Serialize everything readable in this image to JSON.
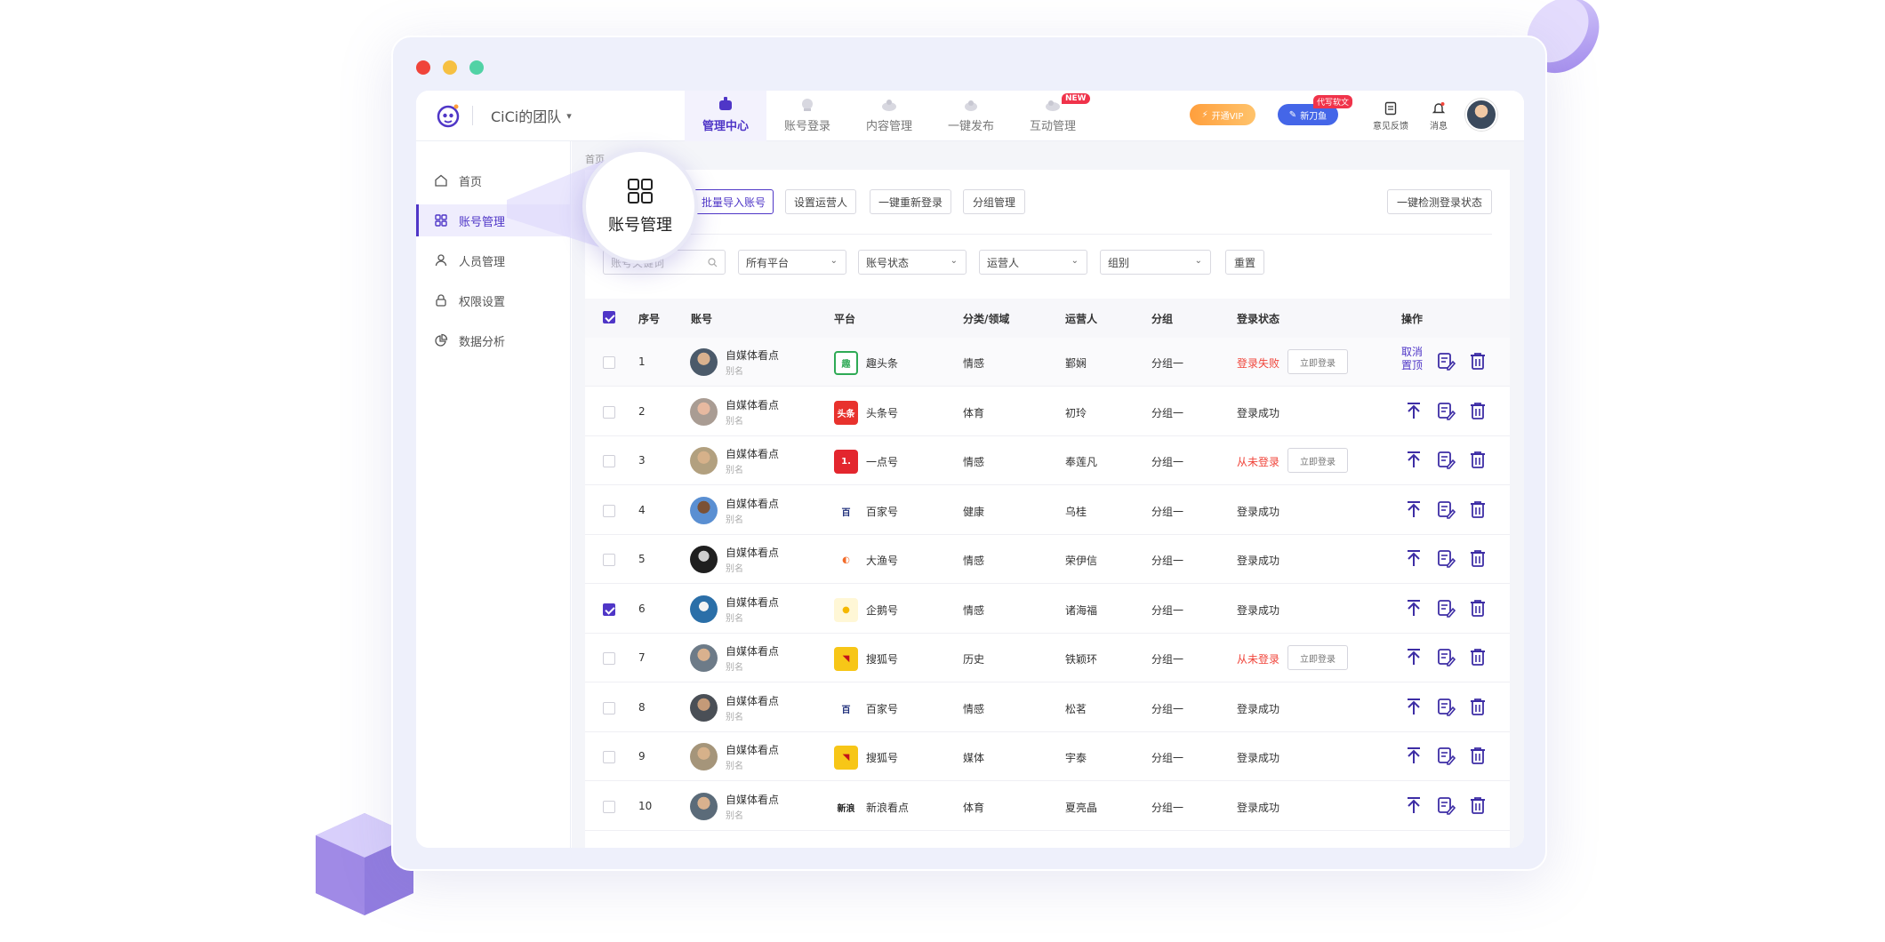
{
  "team": {
    "name": "CiCi的团队"
  },
  "nav": {
    "items": [
      {
        "label": "管理中心",
        "active": true
      },
      {
        "label": "账号登录"
      },
      {
        "label": "内容管理"
      },
      {
        "label": "一键发布"
      },
      {
        "label": "互动管理",
        "badge": "NEW"
      }
    ]
  },
  "topright": {
    "vip_label": "开通VIP",
    "tool_label": "新刀鱼",
    "tool_tag": "代写软文",
    "feedback_label": "意见反馈",
    "message_label": "消息"
  },
  "sidebar": {
    "items": [
      {
        "label": "首页"
      },
      {
        "label": "账号管理",
        "active": true
      },
      {
        "label": "人员管理"
      },
      {
        "label": "权限设置"
      },
      {
        "label": "数据分析"
      }
    ]
  },
  "breadcrumb": "首页",
  "magnifier": {
    "label": "账号管理"
  },
  "toolbar": {
    "batch_import": "批量导入账号",
    "set_operator": "设置运营人",
    "relogin": "一键重新登录",
    "group_manage": "分组管理",
    "check_status": "一键检测登录状态"
  },
  "filters": {
    "keyword_placeholder": "账号关键词",
    "platform": "所有平台",
    "account_status": "账号状态",
    "operator": "运营人",
    "group": "组别",
    "reset": "重置"
  },
  "table": {
    "headers": {
      "index": "序号",
      "account": "账号",
      "platform": "平台",
      "category": "分类/领域",
      "operator": "运营人",
      "group": "分组",
      "login_status": "登录状态",
      "actions": "操作"
    },
    "login_button": "立即登录",
    "unpin_label": "取消置顶",
    "rows": [
      {
        "index": "1",
        "name": "自媒体看点",
        "alias": "别名",
        "platform": "趣头条",
        "category": "情感",
        "operator": "鄞娴",
        "group": "分组一",
        "status": "登录失败",
        "status_type": "fail",
        "checked": false,
        "pinned": true
      },
      {
        "index": "2",
        "name": "自媒体看点",
        "alias": "别名",
        "platform": "头条号",
        "category": "体育",
        "operator": "初玲",
        "group": "分组一",
        "status": "登录成功",
        "status_type": "ok",
        "checked": false
      },
      {
        "index": "3",
        "name": "自媒体看点",
        "alias": "别名",
        "platform": "一点号",
        "category": "情感",
        "operator": "奉莲凡",
        "group": "分组一",
        "status": "从未登录",
        "status_type": "fail",
        "checked": false
      },
      {
        "index": "4",
        "name": "自媒体看点",
        "alias": "别名",
        "platform": "百家号",
        "category": "健康",
        "operator": "乌桂",
        "group": "分组一",
        "status": "登录成功",
        "status_type": "ok",
        "checked": false
      },
      {
        "index": "5",
        "name": "自媒体看点",
        "alias": "别名",
        "platform": "大渔号",
        "category": "情感",
        "operator": "荣伊信",
        "group": "分组一",
        "status": "登录成功",
        "status_type": "ok",
        "checked": false
      },
      {
        "index": "6",
        "name": "自媒体看点",
        "alias": "别名",
        "platform": "企鹅号",
        "category": "情感",
        "operator": "诸海福",
        "group": "分组一",
        "status": "登录成功",
        "status_type": "ok",
        "checked": true
      },
      {
        "index": "7",
        "name": "自媒体看点",
        "alias": "别名",
        "platform": "搜狐号",
        "category": "历史",
        "operator": "铁颖环",
        "group": "分组一",
        "status": "从未登录",
        "status_type": "fail",
        "checked": false
      },
      {
        "index": "8",
        "name": "自媒体看点",
        "alias": "别名",
        "platform": "百家号",
        "category": "情感",
        "operator": "松茗",
        "group": "分组一",
        "status": "登录成功",
        "status_type": "ok",
        "checked": false
      },
      {
        "index": "9",
        "name": "自媒体看点",
        "alias": "别名",
        "platform": "搜狐号",
        "category": "媒体",
        "operator": "宇泰",
        "group": "分组一",
        "status": "登录成功",
        "status_type": "ok",
        "checked": false
      },
      {
        "index": "10",
        "name": "自媒体看点",
        "alias": "别名",
        "platform": "新浪看点",
        "category": "体育",
        "operator": "夏亮晶",
        "group": "分组一",
        "status": "登录成功",
        "status_type": "ok",
        "checked": false
      }
    ]
  },
  "colors": {
    "accent": "#4f36c7",
    "fail": "#f0443a",
    "vip": "#ff9f3d",
    "tool": "#4466e8"
  }
}
